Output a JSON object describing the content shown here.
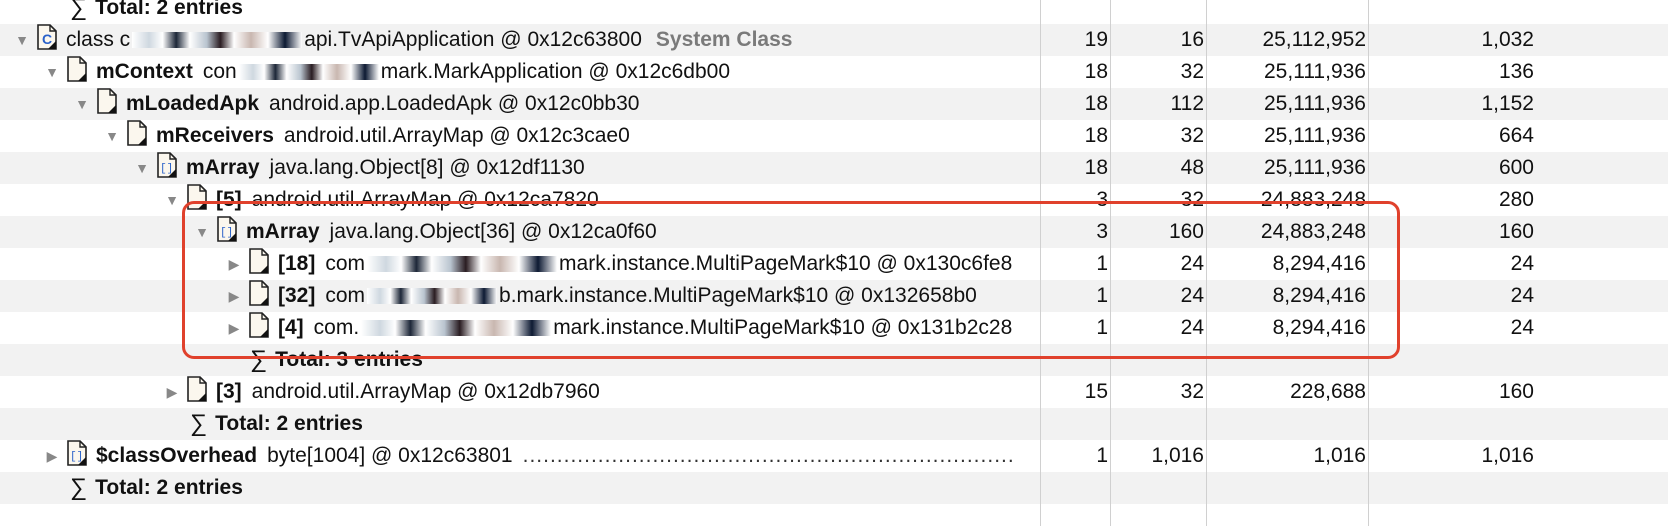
{
  "rows": [
    {
      "tri": "",
      "icon": "sigma",
      "name": "",
      "desc": "Total: 2 entries",
      "bold_desc": true,
      "c1": "",
      "c2": "",
      "c3": "",
      "c4": ""
    },
    {
      "tri": "▼",
      "icon": "class-icon",
      "name": "",
      "desc_pre": "class c",
      "desc_post": "api.TvApiApplication @ 0x12c63800",
      "sys": "System Class",
      "c1": "19",
      "c2": "16",
      "c3": "25,112,952",
      "c4": "1,032"
    },
    {
      "tri": "▼",
      "icon": "doc-icon",
      "name": "mContext",
      "desc_pre": "con",
      "desc_post": "mark.MarkApplication @ 0x12c6db00",
      "c1": "18",
      "c2": "32",
      "c3": "25,111,936",
      "c4": "136"
    },
    {
      "tri": "▼",
      "icon": "doc-icon",
      "name": "mLoadedApk",
      "desc": "android.app.LoadedApk @ 0x12c0bb30",
      "c1": "18",
      "c2": "112",
      "c3": "25,111,936",
      "c4": "1,152"
    },
    {
      "tri": "▼",
      "icon": "doc-icon",
      "name": "mReceivers",
      "desc": "android.util.ArrayMap @ 0x12c3cae0",
      "c1": "18",
      "c2": "32",
      "c3": "25,111,936",
      "c4": "664"
    },
    {
      "tri": "▼",
      "icon": "array-icon",
      "name": "mArray",
      "desc": "java.lang.Object[8] @ 0x12df1130",
      "c1": "18",
      "c2": "48",
      "c3": "25,111,936",
      "c4": "600"
    },
    {
      "tri": "▼",
      "icon": "doc-icon",
      "name": "[5]",
      "desc": "android.util.ArrayMap @ 0x12ca7820",
      "c1": "3",
      "c2": "32",
      "c3": "24,883,248",
      "c4": "280"
    },
    {
      "tri": "▼",
      "icon": "array-icon",
      "name": "mArray",
      "desc": "java.lang.Object[36] @ 0x12ca0f60",
      "c1": "3",
      "c2": "160",
      "c3": "24,883,248",
      "c4": "160"
    },
    {
      "tri": "▶",
      "icon": "doc-icon",
      "name": "[18]",
      "desc_pre": "com",
      "desc_post": "mark.instance.MultiPageMark$10 @ 0x130c6fe8",
      "c1": "1",
      "c2": "24",
      "c3": "8,294,416",
      "c4": "24"
    },
    {
      "tri": "▶",
      "icon": "doc-icon",
      "name": "[32]",
      "desc_pre": "com",
      "desc_post": "b.mark.instance.MultiPageMark$10 @ 0x132658b0",
      "c1": "1",
      "c2": "24",
      "c3": "8,294,416",
      "c4": "24"
    },
    {
      "tri": "▶",
      "icon": "doc-icon",
      "name": "[4]",
      "desc_pre": "com.",
      "desc_post": "mark.instance.MultiPageMark$10 @ 0x131b2c28",
      "c1": "1",
      "c2": "24",
      "c3": "8,294,416",
      "c4": "24"
    },
    {
      "tri": "",
      "icon": "sigma",
      "name": "",
      "desc": "Total: 3 entries",
      "bold_desc": true,
      "c1": "",
      "c2": "",
      "c3": "",
      "c4": ""
    },
    {
      "tri": "▶",
      "icon": "doc-icon",
      "name": "[3]",
      "desc": "android.util.ArrayMap @ 0x12db7960",
      "c1": "15",
      "c2": "32",
      "c3": "228,688",
      "c4": "160"
    },
    {
      "tri": "",
      "icon": "sigma",
      "name": "",
      "desc": "Total: 2 entries",
      "bold_desc": true,
      "c1": "",
      "c2": "",
      "c3": "",
      "c4": ""
    },
    {
      "tri": "▶",
      "icon": "array-icon",
      "name": "$classOverhead",
      "desc": "byte[1004] @ 0x12c63801",
      "dots": true,
      "c1": "1",
      "c2": "1,016",
      "c3": "1,016",
      "c4": "1,016"
    },
    {
      "tri": "",
      "icon": "sigma",
      "name": "",
      "desc": "Total: 2 entries",
      "bold_desc": true,
      "c1": "",
      "c2": "",
      "c3": "",
      "c4": ""
    }
  ],
  "sigma_glyph": "∑",
  "dot_leader": "........................................................................"
}
